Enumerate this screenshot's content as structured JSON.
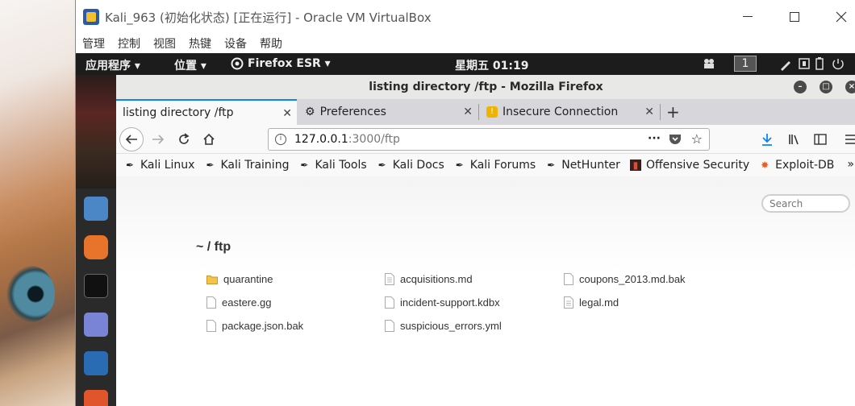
{
  "vbox": {
    "title": "Kali_963 (初始化状态) [正在运行] - Oracle VM VirtualBox",
    "menu": [
      "管理",
      "控制",
      "视图",
      "热键",
      "设备",
      "帮助"
    ]
  },
  "gnome": {
    "apps": "应用程序 ▾",
    "places": "位置 ▾",
    "firefox": "Firefox ESR ▾",
    "clock": "星期五 01:19",
    "workspace": "1"
  },
  "firefox": {
    "window_title": "listing directory /ftp - Mozilla Firefox",
    "tabs": [
      {
        "label": "listing directory /ftp",
        "active": true
      },
      {
        "label": "Preferences",
        "active": false
      },
      {
        "label": "Insecure Connection",
        "active": false
      }
    ],
    "url": {
      "host": "127.0.0.1",
      "path": ":3000/ftp"
    },
    "bookmarks": [
      "Kali Linux",
      "Kali Training",
      "Kali Tools",
      "Kali Docs",
      "Kali Forums",
      "NetHunter",
      "Offensive Security",
      "Exploit-DB"
    ]
  },
  "page": {
    "search_placeholder": "Search",
    "heading": "~ / ftp",
    "files": [
      {
        "name": "quarantine",
        "type": "folder"
      },
      {
        "name": "acquisitions.md",
        "type": "file"
      },
      {
        "name": "coupons_2013.md.bak",
        "type": "file"
      },
      {
        "name": "eastere.gg",
        "type": "file"
      },
      {
        "name": "incident-support.kdbx",
        "type": "file"
      },
      {
        "name": "legal.md",
        "type": "file"
      },
      {
        "name": "package.json.bak",
        "type": "file"
      },
      {
        "name": "suspicious_errors.yml",
        "type": "file"
      }
    ]
  },
  "colors": {
    "accent": "#0a84ff",
    "folder": "#f5c24b"
  }
}
